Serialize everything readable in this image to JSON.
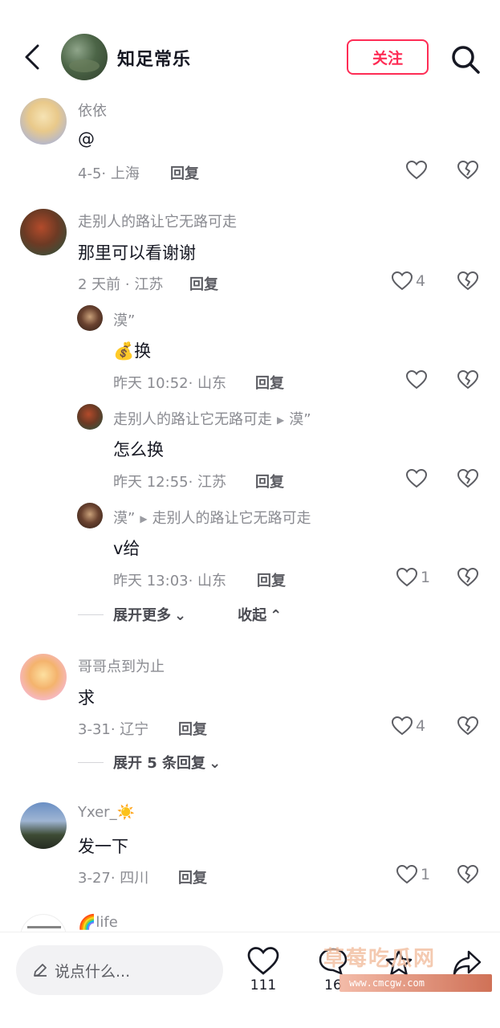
{
  "header": {
    "title": "知足常乐",
    "follow_label": "关注"
  },
  "comments": [
    {
      "username": "依依",
      "text": "@",
      "meta": "4-5· 上海",
      "reply_label": "回复",
      "likes": ""
    },
    {
      "username": "走别人的路让它无路可走",
      "text": "那里可以看谢谢",
      "meta": "2 天前 · 江苏",
      "reply_label": "回复",
      "likes": "4",
      "replies": [
        {
          "username": "漠”",
          "reply_to": "",
          "text": "💰换",
          "meta": "昨天 10:52· 山东",
          "reply_label": "回复",
          "likes": ""
        },
        {
          "username": "走别人的路让它无路可走",
          "reply_to": "漠”",
          "text": "怎么换",
          "meta": "昨天 12:55· 江苏",
          "reply_label": "回复",
          "likes": ""
        },
        {
          "username": "漠”",
          "reply_to": "走别人的路让它无路可走",
          "text": "v给",
          "meta": "昨天 13:03· 山东",
          "reply_label": "回复",
          "likes": "1"
        }
      ],
      "expand_more": "展开更多",
      "collapse": "收起"
    },
    {
      "username": "哥哥点到为止",
      "text": "求",
      "meta": "3-31· 辽宁",
      "reply_label": "回复",
      "likes": "4",
      "expand_replies": "展开 5 条回复"
    },
    {
      "username": "Yxer_☀️",
      "text": "发一下",
      "meta": "3-27· 四川",
      "reply_label": "回复",
      "likes": "1"
    },
    {
      "username": "🌈life"
    }
  ],
  "bottom_bar": {
    "input_placeholder": "说点什么...",
    "like_count": "111",
    "comment_count": "16",
    "watermark_text": "草莓吃瓜网",
    "watermark_url": "www.cmcgw.com"
  }
}
